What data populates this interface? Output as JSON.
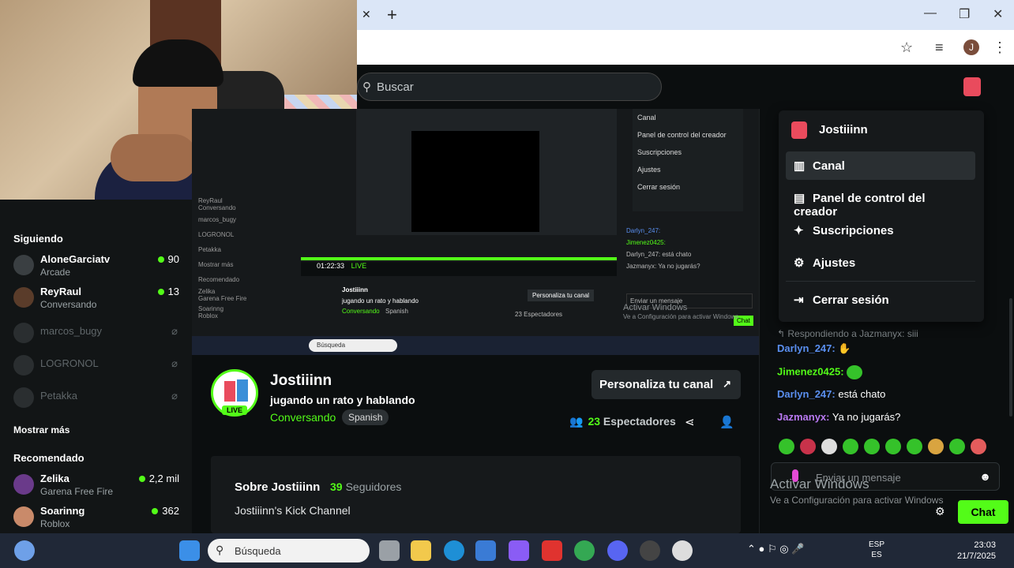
{
  "browser": {
    "close_tab": "✕",
    "new_tab": "+",
    "minimize": "—",
    "maximize": "❐",
    "close_window": "✕",
    "profile_initial": "J"
  },
  "header": {
    "search_placeholder": "Buscar"
  },
  "sidebar": {
    "following_title": "Siguiendo",
    "following": [
      {
        "name": "AloneGarciatv",
        "sub": "Arcade",
        "viewers": "90"
      },
      {
        "name": "ReyRaul",
        "sub": "Conversando",
        "viewers": "13"
      },
      {
        "name": "marcos_bugy"
      },
      {
        "name": "LOGRONOL"
      },
      {
        "name": "Petakka"
      }
    ],
    "show_more": "Mostrar más",
    "recommended_title": "Recomendado",
    "recommended": [
      {
        "name": "Zelika",
        "sub": "Garena Free Fire",
        "viewers": "2,2 mil"
      },
      {
        "name": "Soarinng",
        "sub": "Roblox",
        "viewers": "362"
      }
    ]
  },
  "video": {
    "inner_menu": [
      "Canal",
      "Panel de control del creador",
      "Suscripciones",
      "Ajustes",
      "Cerrar sesión"
    ],
    "inner_time": "01:22:33",
    "inner_live": "LIVE",
    "inner_channel": "Jostiiinn",
    "inner_title": "jugando un rato y hablando",
    "inner_category": "Conversando",
    "inner_lang": "Spanish",
    "inner_button": "Personaliza tu canal",
    "inner_viewers": "23 Espectadores",
    "inner_search": "Búsqueda",
    "watermark_title": "Activar Windows",
    "watermark_sub": "Ve a Configuración para activar Windows",
    "inner_sidebar": [
      "ReyRaul",
      "Conversando",
      "marcos_bugy",
      "LOGRONOL",
      "Petakka",
      "Mostrar más",
      "Recomendado",
      "Zelika",
      "Garena Free Fire",
      "Soarinng",
      "Roblox"
    ],
    "inner_chat": [
      "Darlyn_247:",
      "Jimenez0425:",
      "Darlyn_247: está chato",
      "Jazmanyx: Ya no jugarás?",
      "Enviar un mensaje",
      "Chat"
    ]
  },
  "stream": {
    "channel": "Jostiiinn",
    "live_badge": "LIVE",
    "title": "jugando un rato y hablando",
    "category": "Conversando",
    "language": "Spanish",
    "customize_button": "Personaliza tu canal",
    "viewers_count": "23",
    "viewers_label": "Espectadores"
  },
  "about": {
    "title": "Sobre Jostiiinn",
    "followers_count": "39",
    "followers_label": "Seguidores",
    "description": "Jostiiinn's Kick Channel"
  },
  "chat": {
    "reply_note": "Respondiendo a Jazmanyx: siii",
    "messages": [
      {
        "user": "Darlyn_247:",
        "text": ""
      },
      {
        "user": "Jimenez0425:",
        "text": ""
      },
      {
        "user": "Darlyn_247:",
        "text": "está chato"
      },
      {
        "user": "Jazmanyx:",
        "text": "Ya no jugarás?"
      }
    ],
    "input_placeholder": "Enviar un mensaje",
    "send_button": "Chat",
    "watermark_title": "Activar Windows",
    "watermark_sub": "Ve a Configuración para activar Windows"
  },
  "dropdown": {
    "username": "Jostiiinn",
    "items": [
      "Canal",
      "Panel de control del creador",
      "Suscripciones",
      "Ajustes",
      "Cerrar sesión"
    ]
  },
  "taskbar": {
    "search_placeholder": "Búsqueda",
    "lang_top": "ESP",
    "lang_bottom": "ES",
    "time": "23:03",
    "date": "21/7/2025"
  },
  "colors": {
    "accent": "#53fc18",
    "background": "#0b0e0f",
    "panel": "#16191b"
  }
}
